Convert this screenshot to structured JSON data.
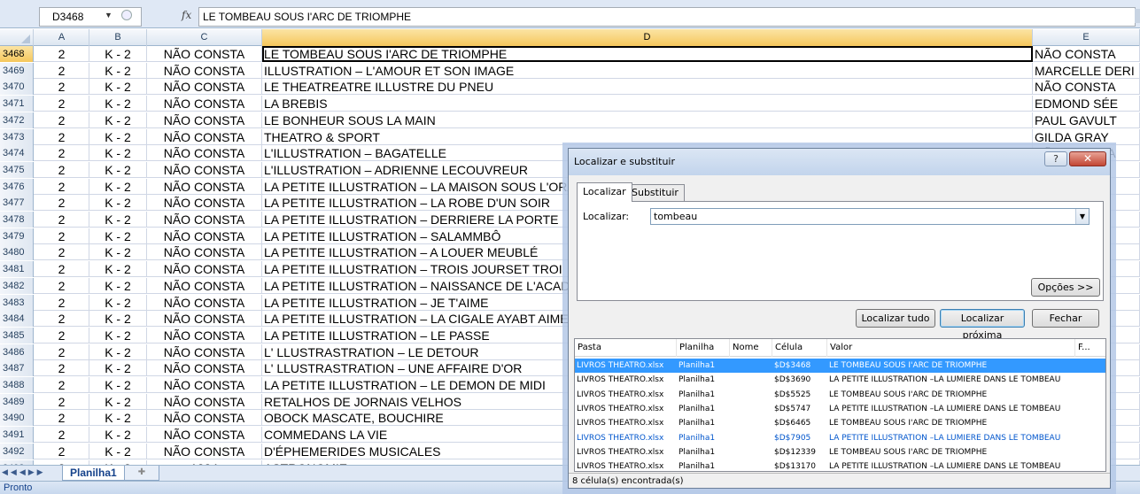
{
  "formula_bar": {
    "name_box": "D3468",
    "fx": "fx",
    "content": "LE TOMBEAU SOUS I'ARC DE TRIOMPHE"
  },
  "columns": [
    "A",
    "B",
    "C",
    "D",
    "E"
  ],
  "rows": [
    {
      "n": "3468",
      "a": "2",
      "b": "K - 2",
      "c": "NÃO CONSTA",
      "d": "LE TOMBEAU SOUS I'ARC DE TRIOMPHE",
      "e": "NÃO CONSTA"
    },
    {
      "n": "3469",
      "a": "2",
      "b": "K - 2",
      "c": "NÃO CONSTA",
      "d": "ILLUSTRATION – L'AMOUR ET SON IMAGE",
      "e": "MARCELLE DERI"
    },
    {
      "n": "3470",
      "a": "2",
      "b": "K - 2",
      "c": "NÃO CONSTA",
      "d": "LE THEATREATRE ILLUSTRE DU PNEU",
      "e": "NÃO CONSTA"
    },
    {
      "n": "3471",
      "a": "2",
      "b": "K - 2",
      "c": "NÃO CONSTA",
      "d": "LA BREBIS",
      "e": "EDMOND SÉE"
    },
    {
      "n": "3472",
      "a": "2",
      "b": "K - 2",
      "c": "NÃO CONSTA",
      "d": "LE BONHEUR SOUS LA MAIN",
      "e": "PAUL GAVULT"
    },
    {
      "n": "3473",
      "a": "2",
      "b": "K - 2",
      "c": "NÃO CONSTA",
      "d": "THEATRO & SPORT",
      "e": "GILDA GRAY"
    },
    {
      "n": "3474",
      "a": "2",
      "b": "K - 2",
      "c": "NÃO CONSTA",
      "d": "L'ILLUSTRATION – BAGATELLE",
      "e": "NÃO CONSTA"
    },
    {
      "n": "3475",
      "a": "2",
      "b": "K - 2",
      "c": "NÃO CONSTA",
      "d": "L'ILLUSTRATION – ADRIENNE LECOUVREUR",
      "e": "RNH"
    },
    {
      "n": "3476",
      "a": "2",
      "b": "K - 2",
      "c": "NÃO CONSTA",
      "d": "LA PETITE ILLUSTRATION – LA MAISON SOUS L'ORA",
      "e": ""
    },
    {
      "n": "3477",
      "a": "2",
      "b": "K - 2",
      "c": "NÃO CONSTA",
      "d": "LA PETITE ILLUSTRATION –  LA ROBE D'UN SOIR",
      "e": "LLIA"
    },
    {
      "n": "3478",
      "a": "2",
      "b": "K - 2",
      "c": "NÃO CONSTA",
      "d": "LA PETITE ILLUSTRATION –  DERRIERE LA PORTE",
      "e": "A"
    },
    {
      "n": "3479",
      "a": "2",
      "b": "K - 2",
      "c": "NÃO CONSTA",
      "d": "LA PETITE ILLUSTRATION –  SALAMMBÔ",
      "e": "A"
    },
    {
      "n": "3480",
      "a": "2",
      "b": "K - 2",
      "c": "NÃO CONSTA",
      "d": "LA PETITE ILLUSTRATION –  A LOUER MEUBLÉ",
      "e": "RIE"
    },
    {
      "n": "3481",
      "a": "2",
      "b": "K - 2",
      "c": "NÃO CONSTA",
      "d": "LA PETITE ILLUSTRATION –  TROIS JOURSET TROI",
      "e": "T"
    },
    {
      "n": "3482",
      "a": "2",
      "b": "K - 2",
      "c": "NÃO CONSTA",
      "d": "LA PETITE ILLUSTRATION –  NAISSANCE DE L'ACAD",
      "e": "T"
    },
    {
      "n": "3483",
      "a": "2",
      "b": "K - 2",
      "c": "NÃO CONSTA",
      "d": "LA PETITE ILLUSTRATION –  JE T'AIME",
      "e": "A"
    },
    {
      "n": "3484",
      "a": "2",
      "b": "K - 2",
      "c": "NÃO CONSTA",
      "d": "LA PETITE ILLUSTRATION –  LA CIGALE AYABT AIME",
      "e": "DTY"
    },
    {
      "n": "3485",
      "a": "2",
      "b": "K - 2",
      "c": "NÃO CONSTA",
      "d": "LA PETITE ILLUSTRATION –  LE PASSE",
      "e": "US"
    },
    {
      "n": "3486",
      "a": "2",
      "b": "K - 2",
      "c": "NÃO CONSTA",
      "d": "L' LLUSTRASTRATION – LE DETOUR",
      "e": "RBS"
    },
    {
      "n": "3487",
      "a": "2",
      "b": "K - 2",
      "c": "NÃO CONSTA",
      "d": "L' LLUSTRASTRATION – UNE AFFAIRE D'OR",
      "e": "A"
    },
    {
      "n": "3488",
      "a": "2",
      "b": "K - 2",
      "c": "NÃO CONSTA",
      "d": "LA PETITE ILLUSTRATION – LE DEMON DE MIDI",
      "e": "ET"
    },
    {
      "n": "3489",
      "a": "2",
      "b": "K - 2",
      "c": "NÃO CONSTA",
      "d": "RETALHOS DE JORNAIS VELHOS",
      "e": "IO"
    },
    {
      "n": "3490",
      "a": "2",
      "b": "K - 2",
      "c": "NÃO CONSTA",
      "d": "OBOCK MASCATE, BOUCHIRE",
      "e": "A"
    },
    {
      "n": "3491",
      "a": "2",
      "b": "K - 2",
      "c": "NÃO CONSTA",
      "d": "COMMEDANS LA VIE",
      "e": "DOF"
    },
    {
      "n": "3492",
      "a": "2",
      "b": "K - 2",
      "c": "NÃO CONSTA",
      "d": "D'ÉPHEMERIDES MUSICALES",
      "e": "ON"
    },
    {
      "n": "3493",
      "a": "2",
      "b": "K - 2",
      "c": "1334",
      "d": "ASTRONOMIE",
      "e": ""
    }
  ],
  "sheet_tab": "Planilha1",
  "status": "Pronto",
  "dialog": {
    "title": "Localizar e substituir",
    "help": "?",
    "close": "✕",
    "tab_find": "Localizar",
    "tab_replace": "Substituir",
    "find_label": "Localizar:",
    "find_value": "tombeau",
    "options_button": "Opções >>",
    "find_all_button": "Localizar tudo",
    "find_next_button": "Localizar próxima",
    "close_button": "Fechar",
    "result_headers": [
      "Pasta",
      "Planilha",
      "Nome",
      "Célula",
      "Valor",
      "F..."
    ],
    "results": [
      {
        "pasta": "LIVROS THEATRO.xlsx",
        "planilha": "Planilha1",
        "celula": "$D$3468",
        "valor": "LE TOMBEAU SOUS I'ARC DE TRIOMPHE"
      },
      {
        "pasta": "LIVROS THEATRO.xlsx",
        "planilha": "Planilha1",
        "celula": "$D$3690",
        "valor": "LA PETITE ILLUSTRATION –LA LUMIERE DANS LE TOMBEAU"
      },
      {
        "pasta": "LIVROS THEATRO.xlsx",
        "planilha": "Planilha1",
        "celula": "$D$5525",
        "valor": "LE TOMBEAU SOUS I'ARC DE TRIOMPHE"
      },
      {
        "pasta": "LIVROS THEATRO.xlsx",
        "planilha": "Planilha1",
        "celula": "$D$5747",
        "valor": "LA PETITE ILLUSTRATION –LA LUMIERE DANS LE TOMBEAU"
      },
      {
        "pasta": "LIVROS THEATRO.xlsx",
        "planilha": "Planilha1",
        "celula": "$D$6465",
        "valor": "LE TOMBEAU SOUS I'ARC DE TRIOMPHE"
      },
      {
        "pasta": "LIVROS THEATRO.xlsx",
        "planilha": "Planilha1",
        "celula": "$D$7905",
        "valor": "LA PETITE ILLUSTRATION –LA LUMIERE DANS LE TOMBEAU"
      },
      {
        "pasta": "LIVROS THEATRO.xlsx",
        "planilha": "Planilha1",
        "celula": "$D$12339",
        "valor": "LE TOMBEAU SOUS I'ARC DE TRIOMPHE"
      },
      {
        "pasta": "LIVROS THEATRO.xlsx",
        "planilha": "Planilha1",
        "celula": "$D$13170",
        "valor": "LA PETITE ILLUSTRATION –LA LUMIERE DANS LE TOMBEAU"
      }
    ],
    "status": "8 célula(s) encontrada(s)"
  }
}
